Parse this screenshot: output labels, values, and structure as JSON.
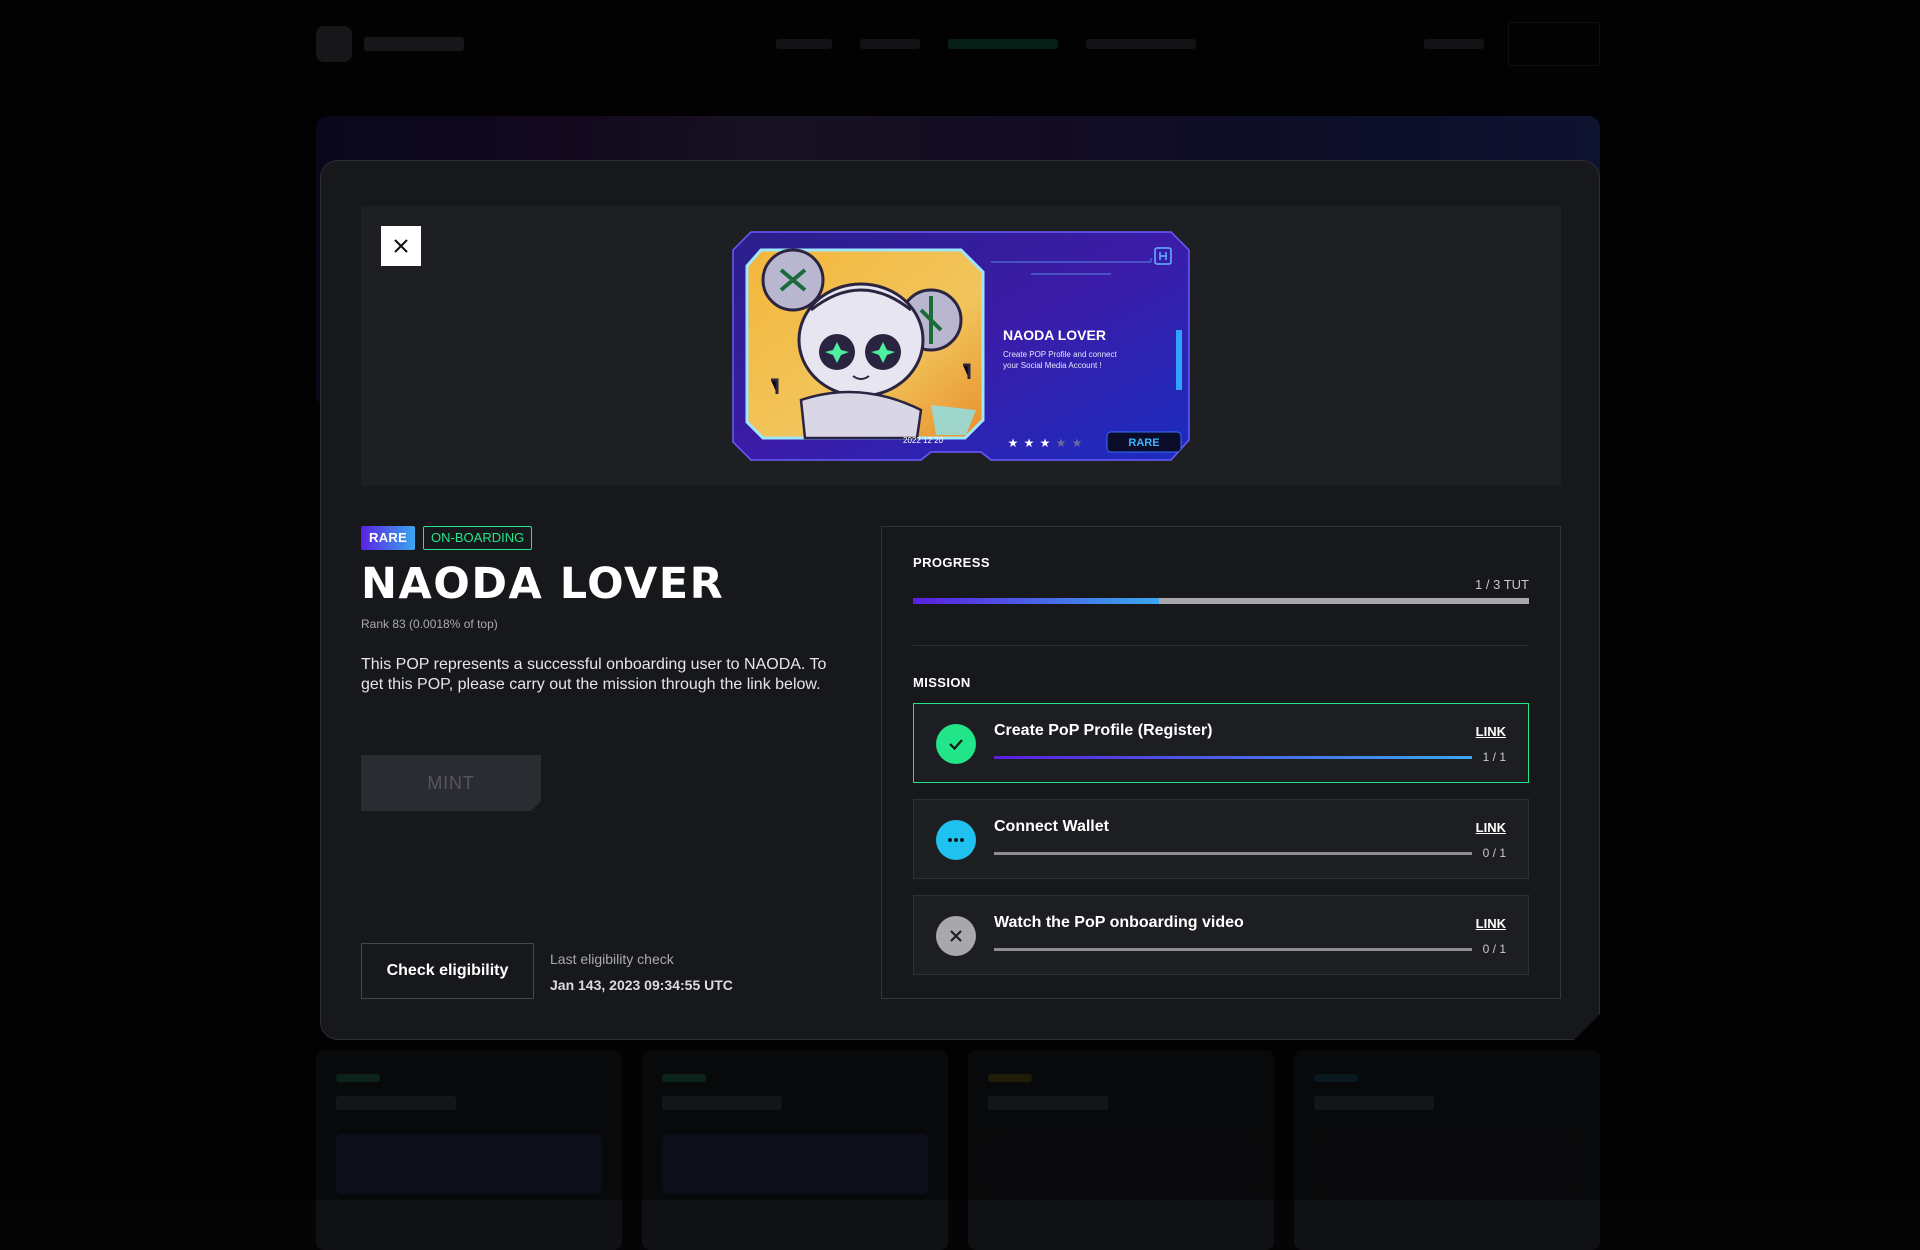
{
  "modal": {
    "card": {
      "title": "NAODA LOVER",
      "subtitle_line1": "Create POP Profile and connect",
      "subtitle_line2": "your Social Media Account !",
      "date": "2022 12 20",
      "rarity": "RARE",
      "stars_filled": 3,
      "stars_total": 5
    },
    "tags": {
      "rarity": "RARE",
      "category": "ON-BOARDING"
    },
    "title": "NAODA LOVER",
    "rank": "Rank 83 (0.0018% of top)",
    "description": "This POP represents a successful onboarding user to NAODA. To get this POP, please carry out the mission through the link below.",
    "mint_label": "MINT",
    "check_label": "Check eligibility",
    "last_check_label": "Last eligibility check",
    "last_check_value": "Jan 143, 2023 09:34:55 UTC",
    "progress": {
      "label": "PROGRESS",
      "count": "1 / 3 TUT",
      "fraction": 0.4
    },
    "mission_label": "MISSION",
    "missions": [
      {
        "title": "Create PoP Profile (Register)",
        "link": "LINK",
        "count": "1 / 1",
        "progress": 1,
        "status": "done",
        "icon": "check-icon"
      },
      {
        "title": "Connect Wallet",
        "link": "LINK",
        "count": "0 / 1",
        "progress": 0,
        "status": "pending",
        "icon": "more-dots-icon"
      },
      {
        "title": "Watch the PoP onboarding video",
        "link": "LINK",
        "count": "0 / 1",
        "progress": 0,
        "status": "failed",
        "icon": "close-icon"
      }
    ]
  },
  "colors": {
    "accent_purple": "#5a1fe0",
    "accent_blue": "#3aa8ee",
    "success_green": "#22e58a",
    "pending_cyan": "#1fc1ee",
    "failed_gray": "#a8a8ac"
  }
}
